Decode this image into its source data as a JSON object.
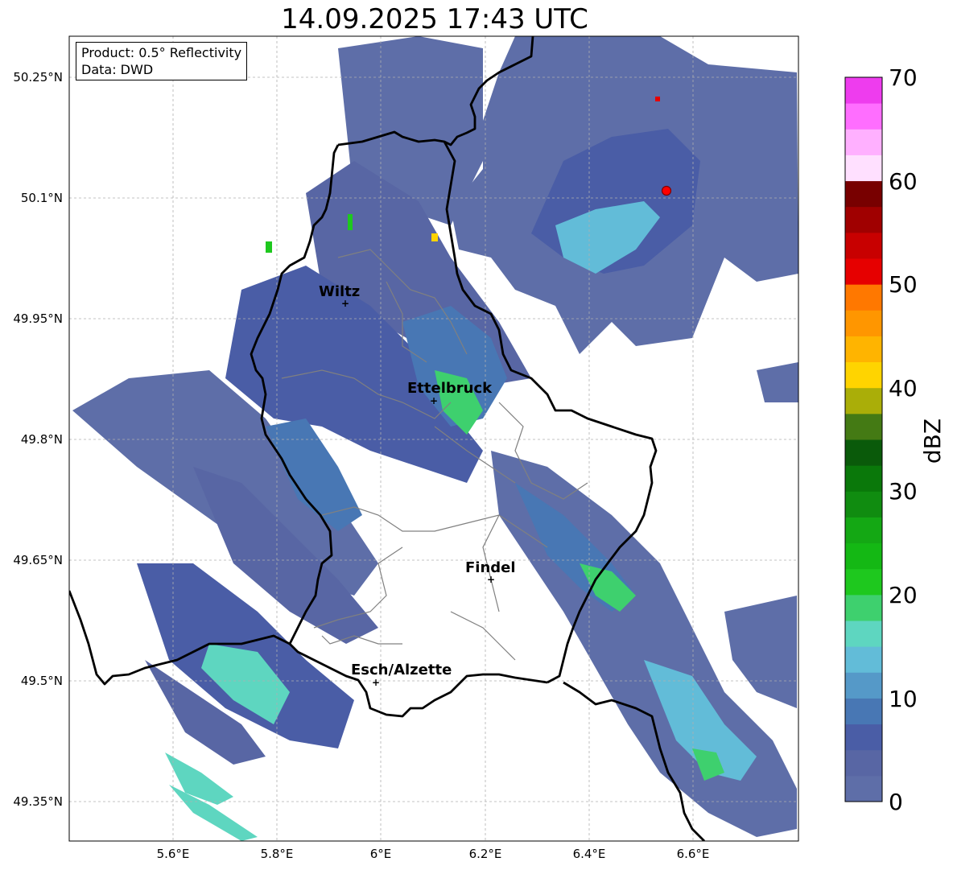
{
  "title": "14.09.2025 17:43 UTC",
  "info": {
    "product": "Product: 0.5° Reflectivity",
    "data": "Data: DWD"
  },
  "axes": {
    "lat_ticks": [
      "50.25°N",
      "50.1°N",
      "49.95°N",
      "49.8°N",
      "49.65°N",
      "49.5°N",
      "49.35°N"
    ],
    "lon_ticks": [
      "5.6°E",
      "5.8°E",
      "6°E",
      "6.2°E",
      "6.4°E",
      "6.6°E"
    ]
  },
  "cities": [
    {
      "name": "Wiltz"
    },
    {
      "name": "Ettelbruck"
    },
    {
      "name": "Findel"
    },
    {
      "name": "Esch/Alzette"
    }
  ],
  "radar_site_color": "#ff0000",
  "colorbar": {
    "label": "dBZ",
    "ticks": [
      "0",
      "10",
      "20",
      "30",
      "40",
      "50",
      "60",
      "70"
    ],
    "colors": [
      "#5e6ea8",
      "#5866a4",
      "#4a5da6",
      "#4877b4",
      "#5599c8",
      "#62bcd8",
      "#5ed6c0",
      "#3ed06e",
      "#1ec81e",
      "#14b814",
      "#14a814",
      "#108c10",
      "#0a780a",
      "#0a5a0a",
      "#447a14",
      "#aaae08",
      "#ffd400",
      "#ffb400",
      "#ff9600",
      "#ff7800",
      "#e60000",
      "#c80000",
      "#a00000",
      "#780000",
      "#ffe0ff",
      "#ffb0ff",
      "#ff6eff",
      "#ee3cee"
    ]
  }
}
